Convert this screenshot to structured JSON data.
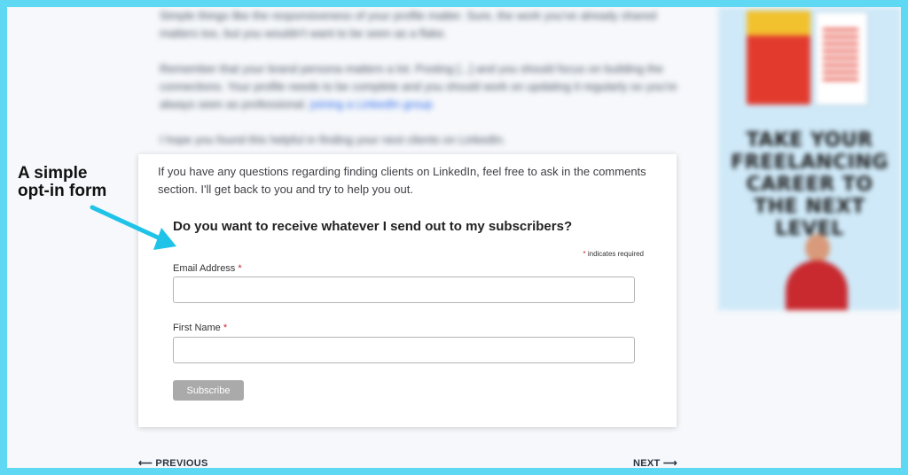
{
  "background": {
    "paragraphs": [
      "Simple things like the responsiveness of your profile matter. Sure, the work you've already shared matters too, but you wouldn't want to be seen as a flake.",
      "Remember that your brand persona matters a lot. Posting [...] and you should focus on building the connections. Your profile needs to be complete and you should work on updating it regularly so you're always seen as professional.",
      "I hope you found this helpful in finding your next clients on LinkedIn."
    ],
    "link_text": "joining a LinkedIn group"
  },
  "sidebar_ad": {
    "headline": "TAKE YOUR FREELANCING CAREER TO THE NEXT LEVEL"
  },
  "annotation": {
    "label_line1": "A simple",
    "label_line2": "opt-in form",
    "arrow_color": "#1fc3e8"
  },
  "card": {
    "intro": "If you have any questions regarding finding clients on LinkedIn, feel free to ask in the comments section. I'll get back to you and try to help you out.",
    "form": {
      "title": "Do you want to receive whatever I send out to my subscribers?",
      "required_star": "*",
      "required_note": "indicates required",
      "email_label": "Email Address",
      "email_value": "",
      "first_name_label": "First Name",
      "first_name_value": "",
      "subscribe_label": "Subscribe"
    }
  },
  "post_nav": {
    "previous": "⟵ PREVIOUS",
    "next": "NEXT ⟶"
  },
  "colors": {
    "frame": "#5fd8f3",
    "required": "#c9252d",
    "button": "#aaaaaa"
  }
}
